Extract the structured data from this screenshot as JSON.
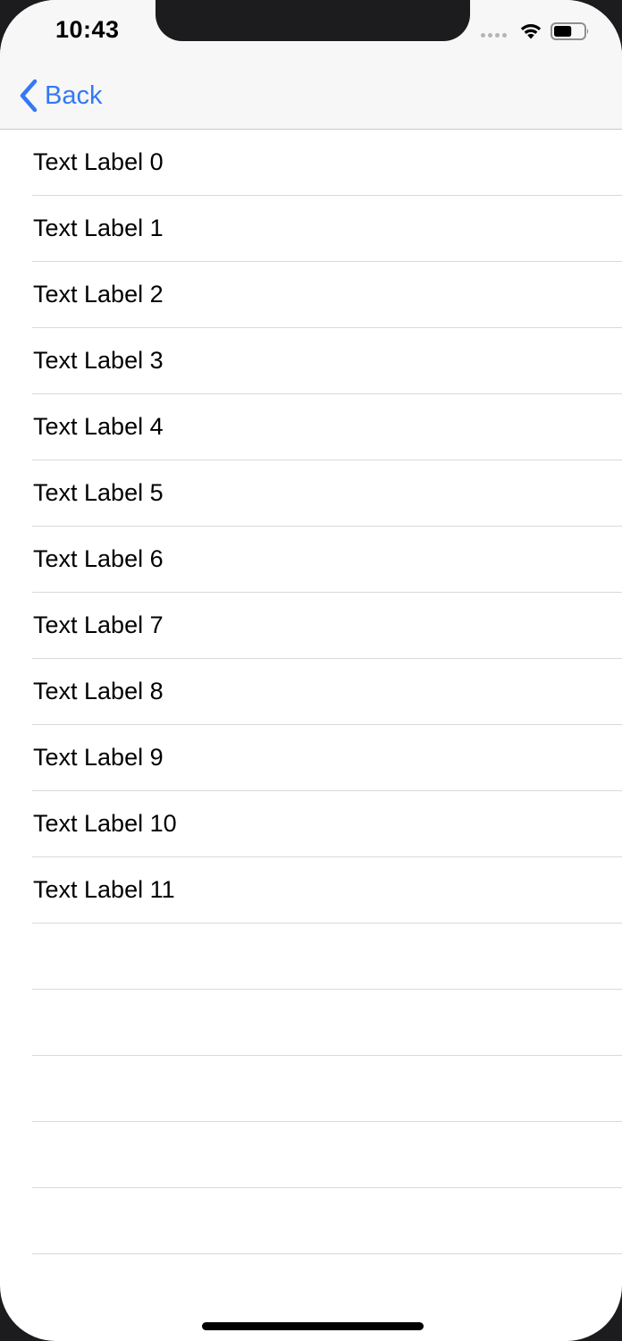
{
  "status_bar": {
    "time": "10:43",
    "signal_icon": "cellular-signal-dots-icon",
    "wifi_icon": "wifi-icon",
    "battery_icon": "battery-icon",
    "battery_level": 0.6
  },
  "nav": {
    "back_icon": "chevron-left-icon",
    "back_label": "Back",
    "accent_color": "#3478F6"
  },
  "table": {
    "rows": [
      {
        "label": "Text Label 0"
      },
      {
        "label": "Text Label 1"
      },
      {
        "label": "Text Label 2"
      },
      {
        "label": "Text Label 3"
      },
      {
        "label": "Text Label 4"
      },
      {
        "label": "Text Label 5"
      },
      {
        "label": "Text Label 6"
      },
      {
        "label": "Text Label 7"
      },
      {
        "label": "Text Label 8"
      },
      {
        "label": "Text Label 9"
      },
      {
        "label": "Text Label 10"
      },
      {
        "label": "Text Label 11"
      },
      {
        "label": ""
      },
      {
        "label": ""
      },
      {
        "label": ""
      },
      {
        "label": ""
      },
      {
        "label": ""
      }
    ]
  }
}
